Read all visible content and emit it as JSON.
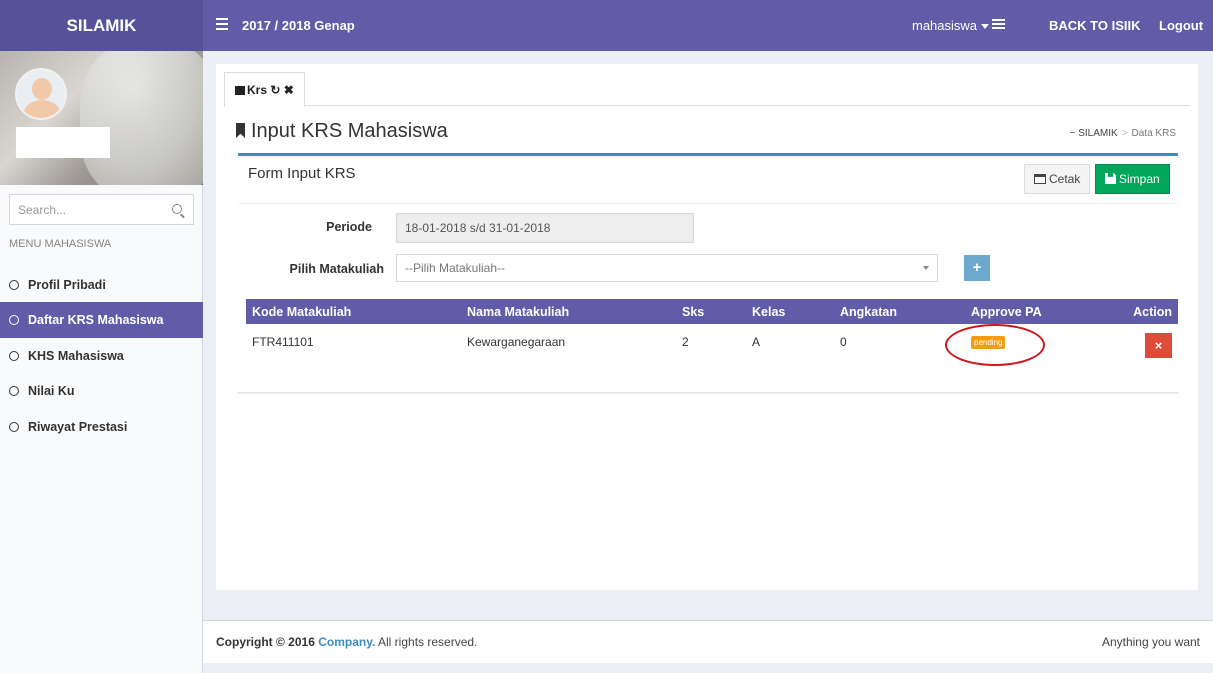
{
  "header": {
    "logo": "SILAMIK",
    "period": "2017 / 2018 Genap",
    "user_menu": "mahasiswa",
    "back_link": "BACK TO ISIIK",
    "logout": "Logout",
    "brand_color": "#605ca8"
  },
  "sidebar": {
    "search_placeholder": "Search...",
    "menu_header": "MENU MAHASISWA",
    "items": [
      {
        "label": "Profil Pribadi",
        "active": false
      },
      {
        "label": "Daftar KRS Mahasiswa",
        "active": true
      },
      {
        "label": "KHS Mahasiswa",
        "active": false
      },
      {
        "label": "Nilai Ku",
        "active": false
      },
      {
        "label": "Riwayat Prestasi",
        "active": false
      }
    ]
  },
  "tab": {
    "label": "Krs"
  },
  "page": {
    "title": "Input KRS Mahasiswa",
    "breadcrumb_root": "~ SILAMIK",
    "breadcrumb_current": "Data KRS"
  },
  "form": {
    "title": "Form Input KRS",
    "print_button": "Cetak",
    "save_button": "Simpan",
    "periode_label": "Periode",
    "periode_value": "18-01-2018 s/d 31-01-2018",
    "matakuliah_label": "Pilih Matakuliah",
    "matakuliah_placeholder": "--Pilih Matakuliah--",
    "add_button": "+"
  },
  "table": {
    "headers": [
      "Kode Matakuliah",
      "Nama Matakuliah",
      "Sks",
      "Kelas",
      "Angkatan",
      "Approve PA",
      "Action"
    ],
    "rows": [
      {
        "kode": "FTR411101",
        "nama": "Kewarganegaraan",
        "sks": "2",
        "kelas": "A",
        "angkatan": "0",
        "approve": "pending",
        "action": "×"
      }
    ]
  },
  "footer": {
    "copyright": "Copyright © 2016",
    "company": "Company.",
    "rights": "All rights reserved.",
    "right_text": "Anything you want"
  }
}
